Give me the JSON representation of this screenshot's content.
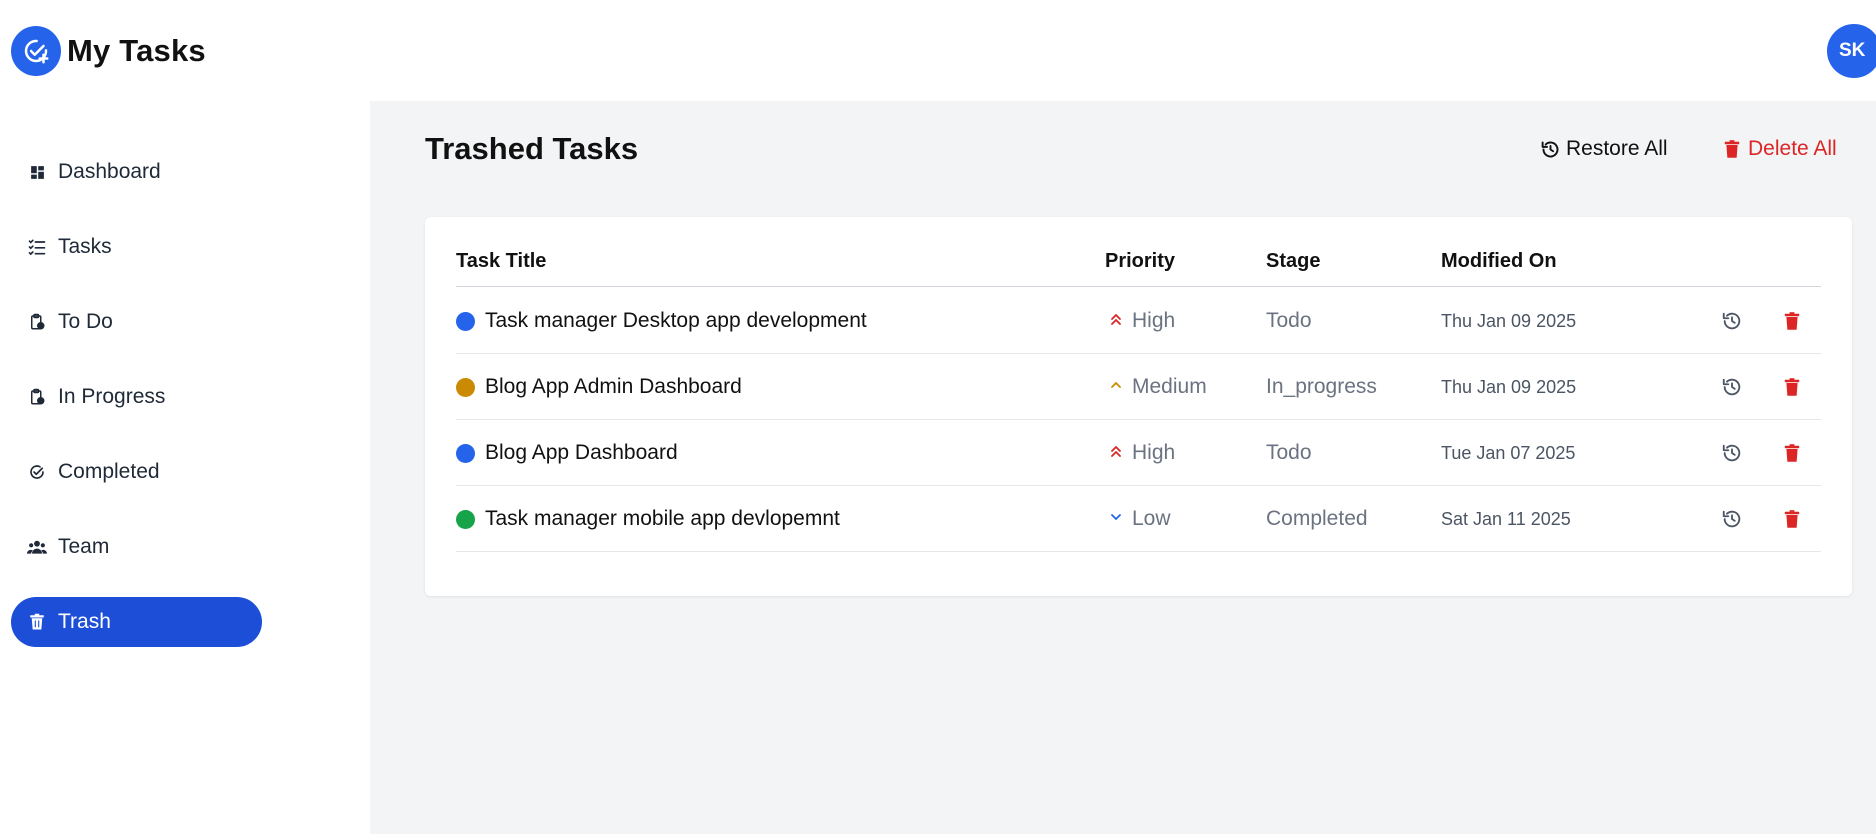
{
  "app": {
    "title": "My Tasks",
    "user_initials": "SK"
  },
  "sidebar": {
    "items": [
      {
        "label": "Dashboard",
        "icon": "dashboard-icon"
      },
      {
        "label": "Tasks",
        "icon": "task-list-icon"
      },
      {
        "label": "To Do",
        "icon": "clipboard-pending-icon"
      },
      {
        "label": "In Progress",
        "icon": "clipboard-progress-icon"
      },
      {
        "label": "Completed",
        "icon": "check-circle-icon"
      },
      {
        "label": "Team",
        "icon": "team-icon"
      },
      {
        "label": "Trash",
        "icon": "trash-icon",
        "active": true
      }
    ]
  },
  "main": {
    "title": "Trashed Tasks",
    "actions": {
      "restore_all": "Restore All",
      "delete_all": "Delete All"
    },
    "table": {
      "headers": [
        "Task Title",
        "Priority",
        "Stage",
        "Modified On"
      ],
      "rows": [
        {
          "title": "Task manager Desktop app development",
          "dot_color": "#2563eb",
          "priority": "High",
          "stage": "Todo",
          "modified": "Thu Jan 09 2025"
        },
        {
          "title": "Blog App Admin Dashboard",
          "dot_color": "#ca8a04",
          "priority": "Medium",
          "stage": "In_progress",
          "modified": "Thu Jan 09 2025"
        },
        {
          "title": "Blog App Dashboard",
          "dot_color": "#2563eb",
          "priority": "High",
          "stage": "Todo",
          "modified": "Tue Jan 07 2025"
        },
        {
          "title": "Task manager mobile app devlopemnt",
          "dot_color": "#16a34a",
          "priority": "Low",
          "stage": "Completed",
          "modified": "Sat Jan 11 2025"
        }
      ]
    }
  },
  "colors": {
    "accent": "#2563eb",
    "active_nav": "#1d4ed8",
    "danger": "#dc2626",
    "priority_high": "#dc2626",
    "priority_medium": "#ca8a04",
    "priority_low": "#2563eb"
  }
}
